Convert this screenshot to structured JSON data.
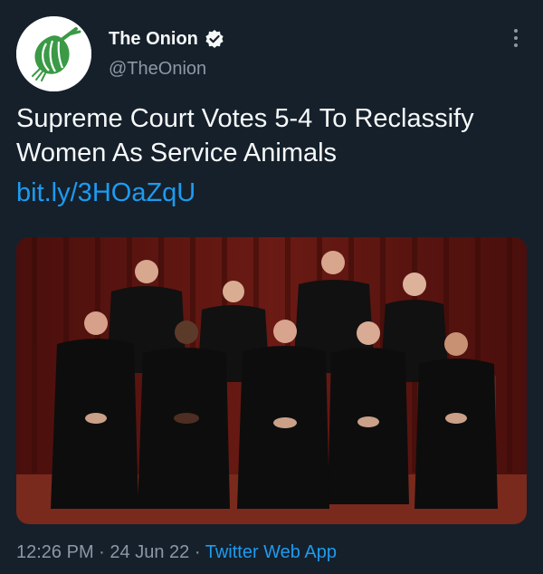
{
  "author": {
    "display_name": "The Onion",
    "handle": "@TheOnion",
    "verified": true,
    "avatar_icon": "onion-logo-icon",
    "brand_color": "#3a9a46"
  },
  "tweet": {
    "text": "Supreme Court Votes 5-4 To Reclassify Women As Service Animals",
    "link": "bit.ly/3HOaZqU",
    "media_description_icon": "photo-icon"
  },
  "meta": {
    "time": "12:26 PM",
    "separator": "·",
    "date": "24 Jun 22",
    "source": "Twitter Web App"
  },
  "colors": {
    "background": "#15202b",
    "text": "#f7f9f9",
    "secondary": "#8b98a5",
    "link": "#1d9bf0"
  }
}
